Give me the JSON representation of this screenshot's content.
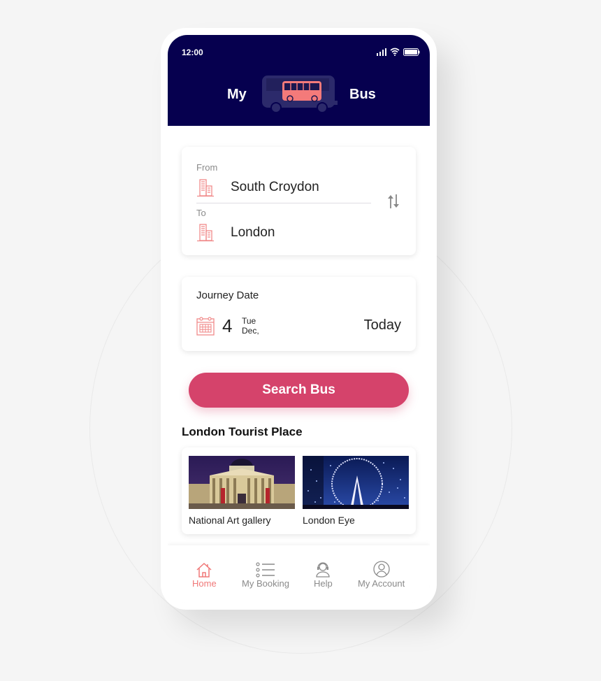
{
  "status_bar": {
    "time": "12:00",
    "icons": [
      "signal-icon",
      "wifi-icon",
      "battery-icon"
    ]
  },
  "header": {
    "brand_left": "My",
    "brand_right": "Bus",
    "logo": "bus-icon",
    "bg_color": "#06004f"
  },
  "route": {
    "from_label": "From",
    "from_value": "South Croydon",
    "to_label": "To",
    "to_value": "London",
    "swap_icon": "swap-vertical-icon"
  },
  "journey": {
    "label": "Journey Date",
    "day": "4",
    "weekday": "Tue",
    "month": "Dec,",
    "relative": "Today"
  },
  "search_button": {
    "label": "Search Bus",
    "color": "#d5436b"
  },
  "tourist": {
    "title": "London Tourist Place",
    "places": [
      {
        "name": "National Art gallery",
        "image": "national-gallery-photo"
      },
      {
        "name": "London Eye",
        "image": "london-eye-photo"
      }
    ]
  },
  "tabbar": {
    "active_color": "#f07878",
    "items": [
      {
        "label": "Home",
        "icon": "home-icon",
        "active": true
      },
      {
        "label": "My Booking",
        "icon": "list-icon",
        "active": false
      },
      {
        "label": "Help",
        "icon": "support-agent-icon",
        "active": false
      },
      {
        "label": "My Account",
        "icon": "user-circle-icon",
        "active": false
      }
    ]
  }
}
